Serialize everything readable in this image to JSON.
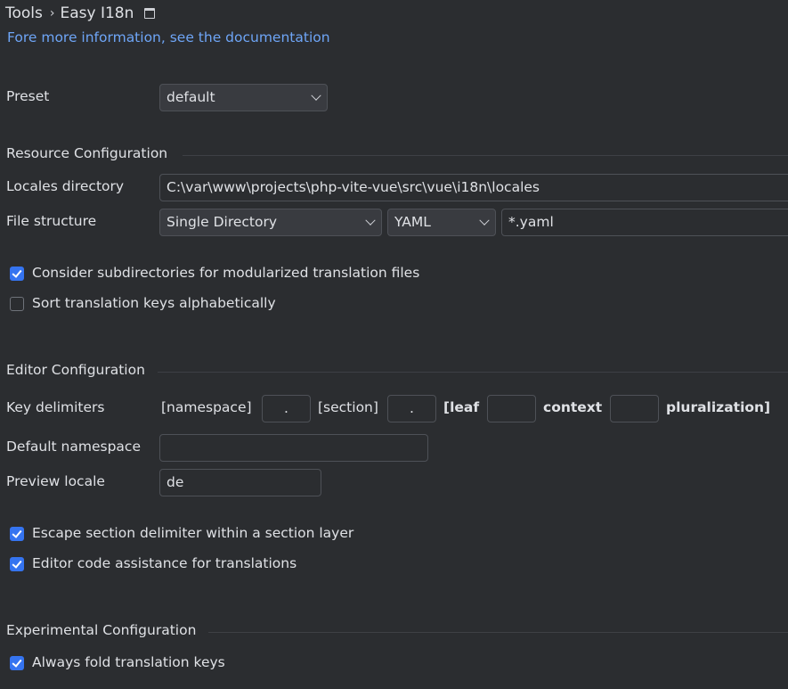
{
  "breadcrumb": {
    "parent": "Tools",
    "separator": "›",
    "current": "Easy I18n"
  },
  "doc_link": "Fore more information, see the documentation",
  "preset": {
    "label": "Preset",
    "value": "default"
  },
  "resource": {
    "title": "Resource Configuration",
    "locales_label": "Locales directory",
    "locales_value": "C:\\var\\www\\projects\\php-vite-vue\\src\\vue\\i18n\\locales",
    "file_structure_label": "File structure",
    "structure_value": "Single Directory",
    "format_value": "YAML",
    "pattern_value": "*.yaml",
    "subdirs_label": "Consider subdirectories for modularized translation files",
    "subdirs_checked": true,
    "sort_label": "Sort translation keys alphabetically",
    "sort_checked": false
  },
  "editor": {
    "title": "Editor Configuration",
    "delims_label": "Key delimiters",
    "namespace_tag": "[namespace]",
    "namespace_delim": ".",
    "section_tag": "[section]",
    "section_delim": ".",
    "leaf_tag": "[leaf",
    "leaf_delim": "",
    "context_tag": "context",
    "context_delim": "",
    "plural_tag": "pluralization]",
    "default_ns_label": "Default namespace",
    "default_ns_value": "",
    "preview_label": "Preview locale",
    "preview_value": "de",
    "escape_label": "Escape section delimiter within a section layer",
    "escape_checked": true,
    "assist_label": "Editor code assistance for translations",
    "assist_checked": true
  },
  "experimental": {
    "title": "Experimental Configuration",
    "fold_label": "Always fold translation keys",
    "fold_checked": true
  },
  "colors": {
    "background": "#2b2d30",
    "link": "#6ea5f6",
    "checkbox_on": "#3574f0",
    "border": "#4e5157"
  }
}
